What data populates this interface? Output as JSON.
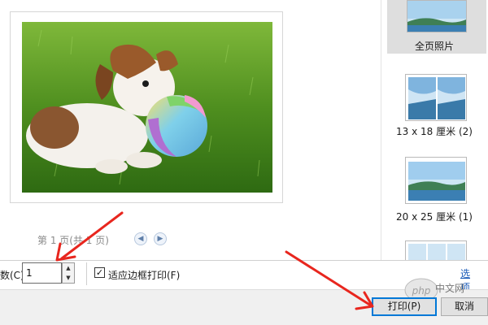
{
  "preview": {
    "page_indicator": "第 1 页(共 1 页)"
  },
  "sidebar": {
    "layouts": [
      {
        "label": "全页照片",
        "selected": true
      },
      {
        "label": "13 x 18 厘米 (2)",
        "selected": false
      },
      {
        "label": "20 x 25 厘米 (1)",
        "selected": false
      }
    ]
  },
  "options": {
    "copies_label": "数(C):",
    "copies_value": "1",
    "fit_label": "适应边框打印(F)",
    "fit_checked": "✓",
    "options_link": "选项..."
  },
  "footer": {
    "print_label": "打印(P)",
    "cancel_label": "取消"
  },
  "watermark": {
    "text": "中文网"
  },
  "colors": {
    "accent": "#0078d7",
    "arrow": "#e8261e",
    "link": "#1a5bb8"
  }
}
